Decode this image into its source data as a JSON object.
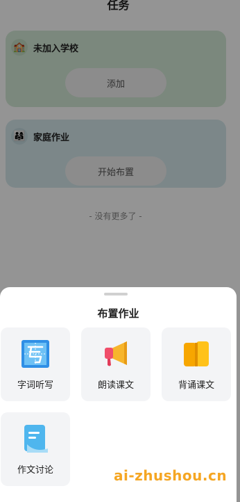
{
  "page_title": "任务",
  "cards": {
    "school": {
      "avatar_icon": "school-icon",
      "title": "未加入学校",
      "button": "添加"
    },
    "family": {
      "avatar_icon": "family-icon",
      "title": "家庭作业",
      "button": "开始布置"
    }
  },
  "no_more_text": "- 没有更多了 -",
  "sheet": {
    "title": "布置作业",
    "tiles": [
      {
        "label": "字词听写",
        "icon": "dictation-icon"
      },
      {
        "label": "朗读课文",
        "icon": "megaphone-icon"
      },
      {
        "label": "背诵课文",
        "icon": "book-icon"
      },
      {
        "label": "作文讨论",
        "icon": "document-icon"
      }
    ]
  },
  "watermark": "ai-zhushou.cn",
  "colors": {
    "school_card": "#d5ead7",
    "family_card": "#d6e8ed",
    "watermark": "#f5a623",
    "tile_bg": "#f3f4f6"
  }
}
